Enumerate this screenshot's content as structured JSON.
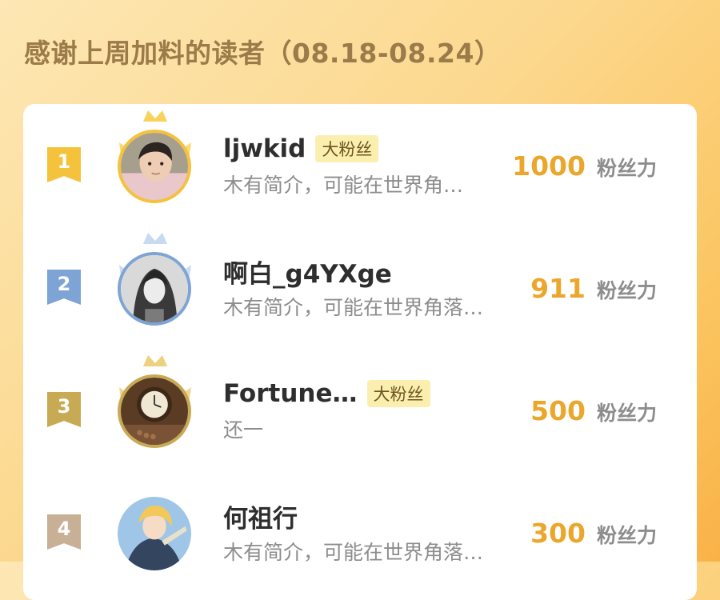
{
  "header": {
    "title": "感谢上周加料的读者（08.18-08.24）"
  },
  "colors": {
    "gold": "#f5c23c",
    "silver": "#7ea4d6",
    "bronze": "#c8aa55",
    "fourth": "#c8b096",
    "score": "#eba62c"
  },
  "readers": [
    {
      "rank": "1",
      "name": "ljwkid",
      "badge": "大粉丝",
      "bio": "木有简介，可能在世界角…",
      "score": "1000",
      "score_unit": "粉丝力",
      "avatar": "child-photo"
    },
    {
      "rank": "2",
      "name": "啊白_g4YXge",
      "badge": "",
      "bio": "木有简介，可能在世界角落…",
      "score": "911",
      "score_unit": "粉丝力",
      "avatar": "anime-man-portrait"
    },
    {
      "rank": "3",
      "name": "Fortune…",
      "badge": "大粉丝",
      "bio": "还一",
      "score": "500",
      "score_unit": "粉丝力",
      "avatar": "clock-photo"
    },
    {
      "rank": "4",
      "name": "何祖行",
      "badge": "",
      "bio": "木有简介，可能在世界角落…",
      "score": "300",
      "score_unit": "粉丝力",
      "avatar": "anime-character"
    }
  ]
}
